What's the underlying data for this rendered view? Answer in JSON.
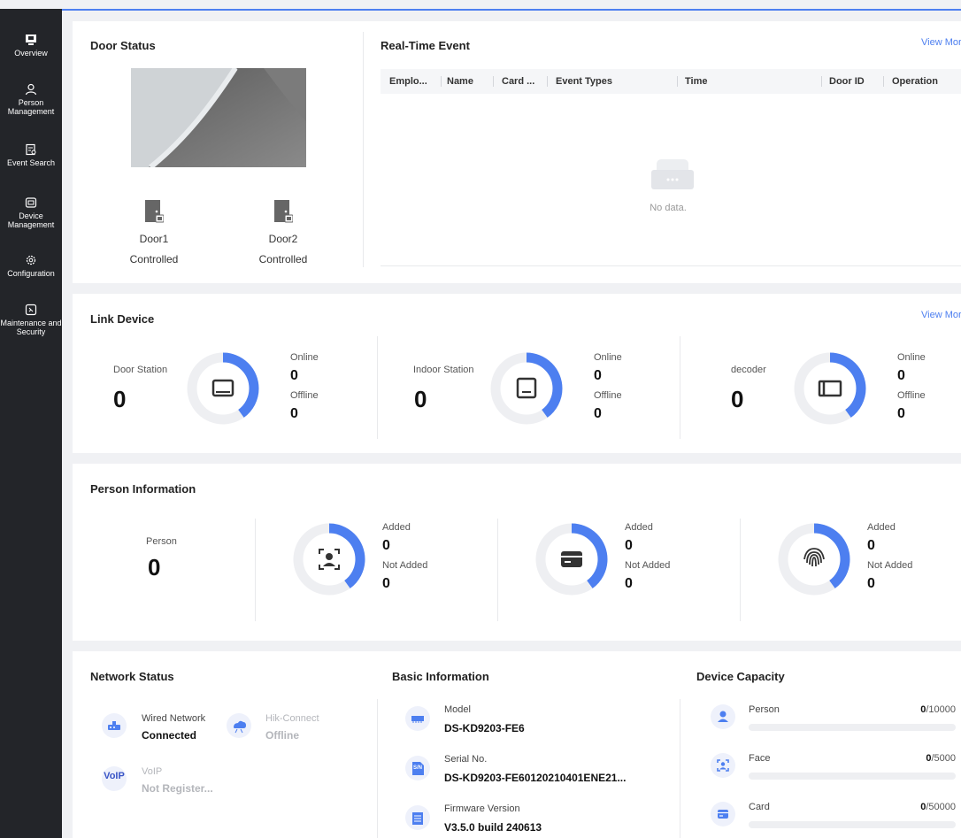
{
  "sidebar": {
    "items": [
      {
        "label": "Overview",
        "icon": "monitor-icon",
        "active": true
      },
      {
        "label": "Person Management",
        "icon": "person-icon"
      },
      {
        "label": "Event Search",
        "icon": "event-search-icon"
      },
      {
        "label": "Device Management",
        "icon": "device-icon"
      },
      {
        "label": "Configuration",
        "icon": "gear-icon"
      },
      {
        "label": "Maintenance and Security",
        "icon": "shield-icon"
      }
    ]
  },
  "door_status": {
    "title": "Door Status",
    "doors": [
      {
        "name": "Door1",
        "state": "Controlled"
      },
      {
        "name": "Door2",
        "state": "Controlled"
      }
    ]
  },
  "realtime": {
    "title": "Real-Time Event",
    "view_more": "View More",
    "columns": [
      "Emplo...",
      "Name",
      "Card ...",
      "Event Types",
      "Time",
      "Door ID",
      "Operation"
    ],
    "empty_text": "No data."
  },
  "link_device": {
    "title": "Link Device",
    "view_more": "View More",
    "online_label": "Online",
    "offline_label": "Offline",
    "groups": [
      {
        "name": "Door Station",
        "total": "0",
        "online": "0",
        "offline": "0",
        "icon": "door-station-icon",
        "fill": 0.4
      },
      {
        "name": "Indoor Station",
        "total": "0",
        "online": "0",
        "offline": "0",
        "icon": "indoor-station-icon",
        "fill": 0.4
      },
      {
        "name": "decoder",
        "total": "0",
        "online": "0",
        "offline": "0",
        "icon": "decoder-icon",
        "fill": 0.4
      }
    ]
  },
  "person_info": {
    "title": "Person Information",
    "person_label": "Person",
    "person_total": "0",
    "added_label": "Added",
    "not_added_label": "Not Added",
    "groups": [
      {
        "icon": "face-icon",
        "added": "0",
        "not_added": "0",
        "fill": 0.4
      },
      {
        "icon": "card-icon",
        "added": "0",
        "not_added": "0",
        "fill": 0.4
      },
      {
        "icon": "fingerprint-icon",
        "added": "0",
        "not_added": "0",
        "fill": 0.4
      }
    ]
  },
  "network": {
    "title": "Network Status",
    "wired": {
      "label": "Wired Network",
      "value": "Connected"
    },
    "hik": {
      "label": "Hik-Connect",
      "value": "Offline"
    },
    "voip": {
      "label": "VoIP",
      "value": "Not Register...",
      "badge": "VoIP"
    }
  },
  "basic": {
    "title": "Basic Information",
    "model": {
      "label": "Model",
      "value": "DS-KD9203-FE6"
    },
    "serial": {
      "label": "Serial No.",
      "value": "DS-KD9203-FE60120210401ENE21...",
      "badge": "S/N"
    },
    "firmware": {
      "label": "Firmware Version",
      "value": "V3.5.0 build 240613"
    }
  },
  "capacity": {
    "title": "Device Capacity",
    "items": [
      {
        "label": "Person",
        "used": "0",
        "max": "/10000",
        "icon": "person-icon"
      },
      {
        "label": "Face",
        "used": "0",
        "max": "/5000",
        "icon": "face-icon"
      },
      {
        "label": "Card",
        "used": "0",
        "max": "/50000",
        "icon": "card-icon"
      }
    ]
  },
  "colors": {
    "accent": "#4d7ff0",
    "sidebar_bg": "#232529",
    "track": "#eeeff2"
  }
}
